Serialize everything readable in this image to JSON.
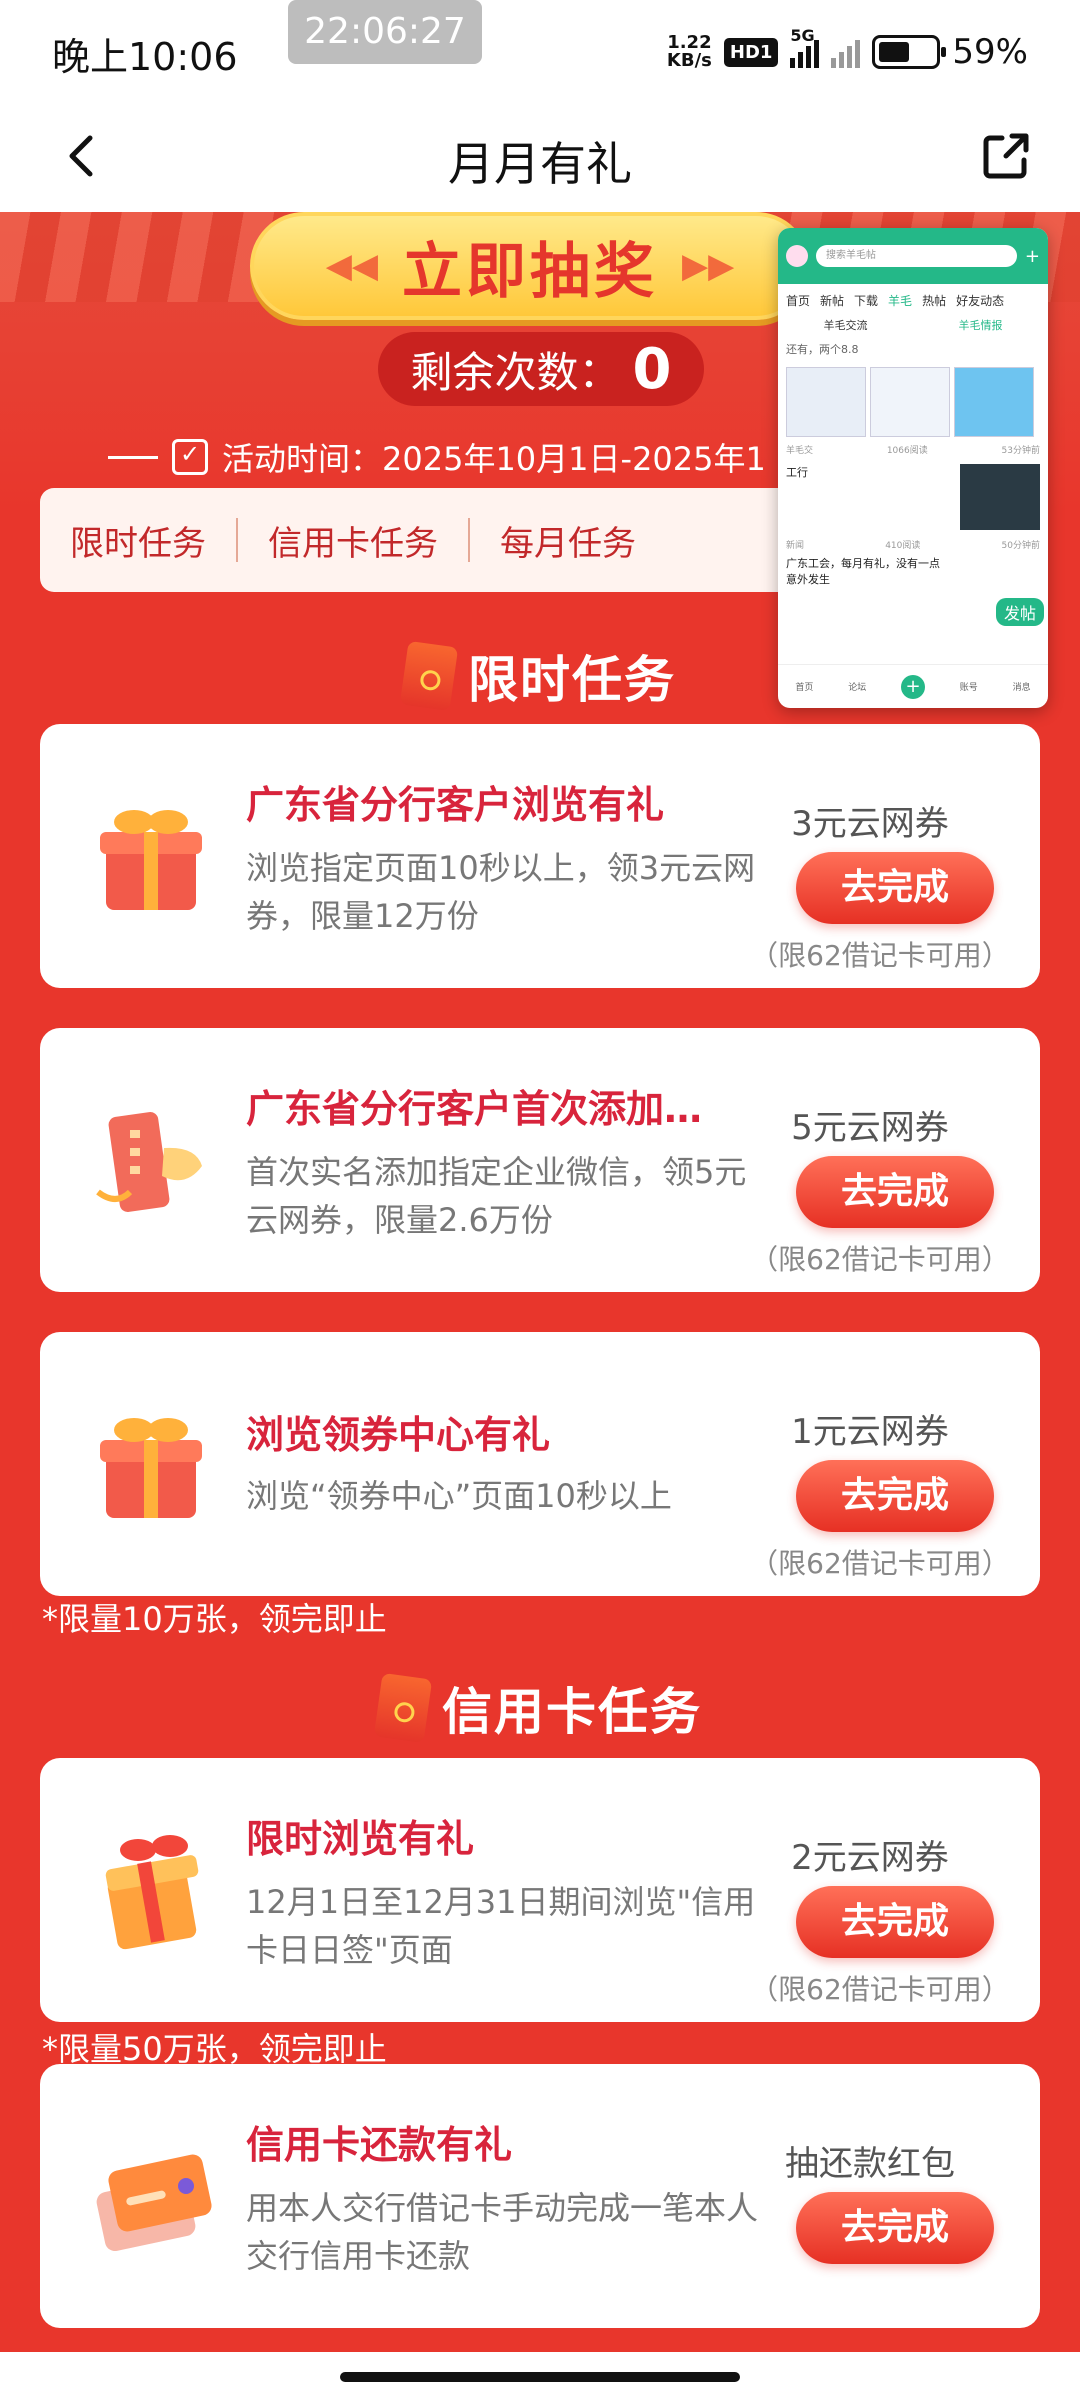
{
  "status_bar": {
    "time": "晚上10:06",
    "recording_time": "22:06:27",
    "net_speed_value": "1.22",
    "net_speed_unit": "KB/s",
    "hd": "HD1",
    "network": "5G",
    "battery": "59%"
  },
  "nav": {
    "title": "月月有礼",
    "back_icon": "chevron-left-icon",
    "share_icon": "share-icon"
  },
  "hero": {
    "draw_button": "立即抽奖",
    "remaining_label": "剩余次数：",
    "remaining_count": "0",
    "period": "活动时间：2025年10月1日-2025年1"
  },
  "tabs": [
    "限时任务",
    "信用卡任务",
    "每月任务"
  ],
  "sections": {
    "limited": "限时任务",
    "credit": "信用卡任务"
  },
  "tasks": [
    {
      "title": "广东省分行客户浏览有礼",
      "desc": "浏览指定页面10秒以上，领3元云网券，限量12万份",
      "reward": "3元云网券",
      "button": "去完成",
      "note": "（限62借记卡可用）",
      "icon": "gift-box-icon"
    },
    {
      "title": "广东省分行客户首次添加…",
      "desc": "首次实名添加指定企业微信，领5元云网券，限量2.6万份",
      "reward": "5元云网券",
      "button": "去完成",
      "note": "（限62借记卡可用）",
      "icon": "card-coupon-icon"
    },
    {
      "title": "浏览领券中心有礼",
      "desc": "浏览“领券中心”页面10秒以上",
      "reward": "1元云网券",
      "button": "去完成",
      "note": "（限62借记卡可用）",
      "icon": "gift-box-icon"
    },
    {
      "title": "限时浏览有礼",
      "desc": "12月1日至12月31日期间浏览\"信用卡日日签\"页面",
      "reward": "2元云网券",
      "button": "去完成",
      "note": "（限62借记卡可用）",
      "icon": "gift-box-icon"
    },
    {
      "title": "信用卡还款有礼",
      "desc": "用本人交行借记卡手动完成一笔本人交行信用卡还款",
      "reward": "抽还款红包",
      "button": "去完成",
      "icon": "credit-card-icon"
    }
  ],
  "limits": {
    "after_limited": "*限量10万张，领完即止",
    "after_credit_1": "*限量50万张，领完即止"
  },
  "floating_window": {
    "search_placeholder": "搜索羊毛帖",
    "tabs": [
      "首页",
      "新帖",
      "下载",
      "羊毛",
      "热帖",
      "好友动态"
    ],
    "sub_tabs": [
      "羊毛交流",
      "羊毛情报"
    ],
    "line1": "还有，两个8.8",
    "meta1_left": "羊毛交",
    "meta1_mid": "1066阅读",
    "meta1_right": "53分钟前",
    "row2_title": "工行",
    "meta2_left": "新闻",
    "meta2_mid": "410阅读",
    "meta2_right": "50分钟前",
    "post_button": "发帖",
    "line3": "广东工会，每月有礼，没有一点意外发生",
    "nav": [
      "首页",
      "论坛",
      "",
      "账号",
      "消息"
    ]
  }
}
